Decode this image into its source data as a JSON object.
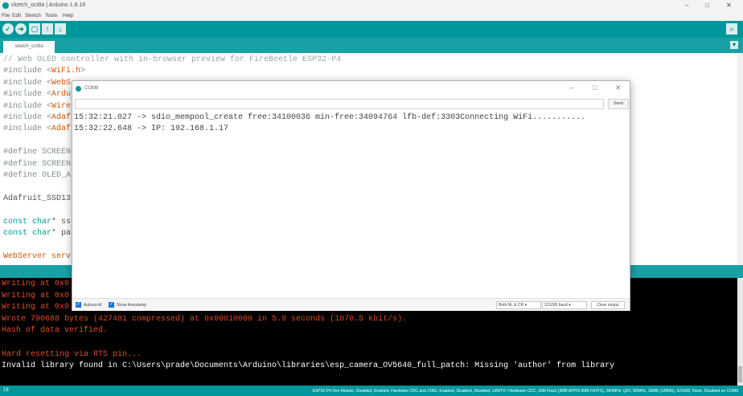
{
  "window": {
    "title": "sketch_oct8a | Arduino 1.8.19",
    "controls": [
      "–",
      "□",
      "✕"
    ]
  },
  "menu": [
    "File",
    "Edit",
    "Sketch",
    "Tools",
    "Help"
  ],
  "toolbar": {
    "buttons": [
      "verify-icon",
      "upload-icon",
      "new-icon",
      "open-icon",
      "save-icon",
      "serial-monitor-icon"
    ]
  },
  "tab": {
    "label": "sketch_oct8a"
  },
  "editor": {
    "lines": [
      {
        "t": "// Web OLED controller with in-browser preview for FireBeetle ESP32-P4",
        "c": "comment"
      },
      {
        "parts": [
          {
            "t": "#include <",
            "c": "pre"
          },
          {
            "t": "WiFi.h",
            "c": "lib"
          },
          {
            "t": ">",
            "c": "pre"
          }
        ]
      },
      {
        "parts": [
          {
            "t": "#include <",
            "c": "pre"
          },
          {
            "t": "WebS",
            "c": "lib"
          }
        ]
      },
      {
        "parts": [
          {
            "t": "#include <",
            "c": "pre"
          },
          {
            "t": "Ardu",
            "c": "lib"
          }
        ]
      },
      {
        "parts": [
          {
            "t": "#include <",
            "c": "pre"
          },
          {
            "t": "Wire",
            "c": "lib"
          }
        ]
      },
      {
        "parts": [
          {
            "t": "#include <",
            "c": "pre"
          },
          {
            "t": "Adaf",
            "c": "lib"
          }
        ]
      },
      {
        "parts": [
          {
            "t": "#include <",
            "c": "pre"
          },
          {
            "t": "Adaf",
            "c": "lib"
          }
        ]
      },
      {
        "parts": []
      },
      {
        "parts": [
          {
            "t": "#define SCREEN",
            "c": "pre"
          }
        ]
      },
      {
        "parts": [
          {
            "t": "#define SCREEN",
            "c": "pre"
          }
        ]
      },
      {
        "parts": [
          {
            "t": "#define OLED_A",
            "c": "pre"
          }
        ]
      },
      {
        "parts": []
      },
      {
        "parts": [
          {
            "t": "Adafruit_SSD13",
            "c": "plain"
          }
        ]
      },
      {
        "parts": []
      },
      {
        "parts": [
          {
            "t": "const ",
            "c": "kw"
          },
          {
            "t": "char",
            "c": "kw"
          },
          {
            "t": "* ss",
            "c": "plain"
          }
        ]
      },
      {
        "parts": [
          {
            "t": "const ",
            "c": "kw"
          },
          {
            "t": "char",
            "c": "kw"
          },
          {
            "t": "* pa",
            "c": "plain"
          }
        ]
      },
      {
        "parts": []
      },
      {
        "parts": [
          {
            "t": "WebServer serv",
            "c": "red"
          }
        ]
      }
    ]
  },
  "console": {
    "lines": [
      {
        "t": "Writing at 0x0",
        "c": "orange"
      },
      {
        "t": "Writing at 0x0",
        "c": "orange"
      },
      {
        "t": "Writing at 0x0",
        "c": "orange"
      },
      {
        "t": "Wrote 790688 bytes (427481 compressed) at 0x00010000 in 5.9 seconds (1070.5 kbit/s).",
        "c": "orange"
      },
      {
        "t": "Hash of data verified.",
        "c": "orange"
      },
      {
        "t": "",
        "c": "orange"
      },
      {
        "t": "Hard resetting via RTS pin...",
        "c": "orange"
      },
      {
        "t": "Invalid library found in C:\\Users\\prade\\Documents\\Arduino\\libraries\\esp_camera_OV5640_full_patch: Missing 'author' from library",
        "c": "white"
      }
    ]
  },
  "statusbar": {
    "line_number": "18",
    "board": "ESP32-P4 Dev Module, Disabled, Enabled, Hardware CDC and JTAG, Enabled, Disabled, Disabled, UART0 / Hardware CDC, 16M Flash (3MB APP/9.9MB FATFS), 360MHz, QIO, 80MHz, 16MB (128Mb), 921600, None, Disabled on COM8"
  },
  "serial_monitor": {
    "title": "COM8",
    "input_value": "",
    "send_label": "Send",
    "output": [
      "15:32:21.027 -> sdio_mempool_create free:34100036 min-free:34094764 lfb-def:3303Connecting WiFi...........",
      "15:32:22.648 -> IP: 192.168.1.17"
    ],
    "autoscroll_label": "Autoscroll",
    "timestamp_label": "Show timestamp",
    "autoscroll_checked": true,
    "timestamp_checked": true,
    "line_ending": "Both NL & CR",
    "baud": "115200 baud",
    "clear_label": "Clear output"
  },
  "colors": {
    "accent": "#00979c",
    "accent_light": "#17a1a5",
    "console_bg": "#000000",
    "console_text": "#e34c26"
  }
}
